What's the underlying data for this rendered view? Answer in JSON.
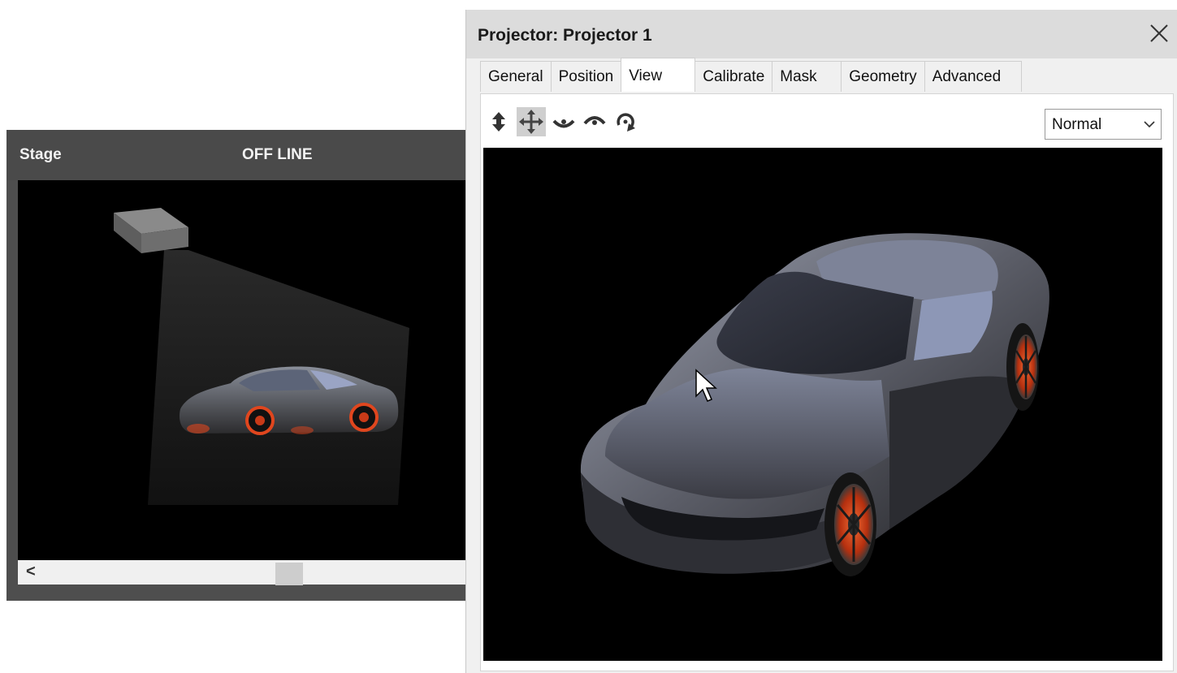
{
  "stage": {
    "title": "Stage",
    "status": "OFF LINE",
    "scroll_left_glyph": "<"
  },
  "dialog": {
    "title": "Projector: Projector 1",
    "close_icon": "close-icon",
    "tabs": [
      "General",
      "Position",
      "View",
      "Calibrate",
      "Mask",
      "Geometry",
      "Advanced"
    ],
    "active_tab": "View",
    "toolbar": {
      "icons": [
        "vertical-move-icon",
        "pan-move-icon",
        "orbit-down-icon",
        "orbit-up-icon",
        "rotate-icon"
      ],
      "selected_icon": "pan-move-icon"
    },
    "mode_select": {
      "value": "Normal"
    }
  },
  "colors": {
    "stage_header": "#4a4a4a",
    "dialog_bg": "#f0f0f0",
    "wheel_accent": "#e0461e"
  }
}
